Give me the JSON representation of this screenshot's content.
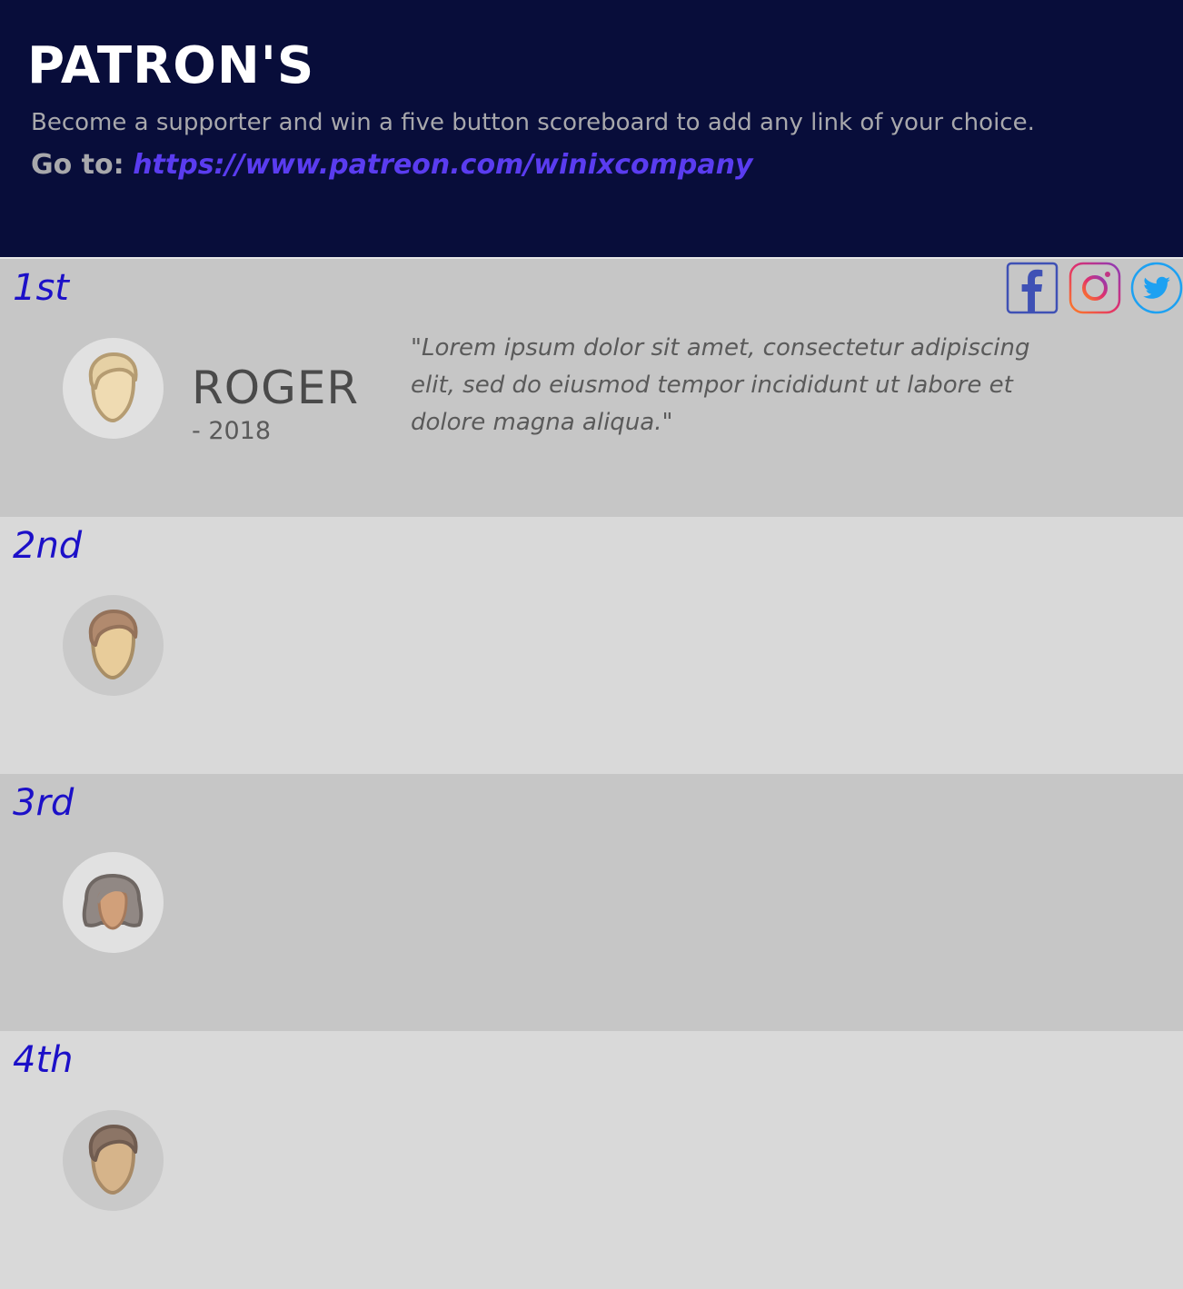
{
  "header": {
    "title": "PATRON'S",
    "subtitle": "Become a supporter and win a five button scoreboard to add any link of your choice.",
    "goto_label": "Go to:",
    "goto_link": "https://www.patreon.com/winixcompany"
  },
  "colors": {
    "header_bg": "#080d3a",
    "rank_text": "#1c10c8",
    "link": "#5a3cf0",
    "row_dark": "#c6c6c6",
    "row_light": "#d9d9d9"
  },
  "patrons": [
    {
      "rank": "1st",
      "name": "ROGER",
      "year": "- 2018",
      "quote": "\"Lorem ipsum dolor sit amet, consectetur adipiscing elit, sed do eiusmod tempor incididunt ut labore et dolore magna aliqua.\"",
      "avatar_icon": "blond-man-icon",
      "social_icons": [
        "facebook-icon",
        "instagram-icon",
        "twitter-icon"
      ]
    },
    {
      "rank": "2nd",
      "avatar_icon": "brown-hair-man-icon"
    },
    {
      "rank": "3rd",
      "avatar_icon": "woman-icon"
    },
    {
      "rank": "4th",
      "avatar_icon": "dark-hair-man-icon"
    }
  ]
}
